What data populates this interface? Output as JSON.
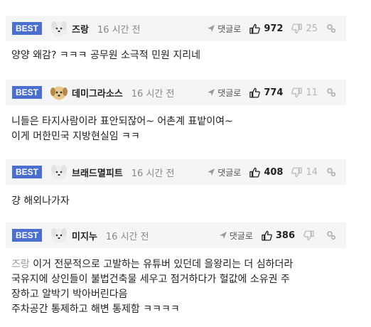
{
  "comments": [
    {
      "badge": "BEST",
      "nick": "즈랑",
      "time": "16 시간 전",
      "reply_label": "댓글로",
      "likes": "972",
      "dislikes": "25",
      "avatar": "white-dog-avatar",
      "text": "양양 왜감? ㅋㅋㅋ 공무원 소극적 민원 지리네"
    },
    {
      "badge": "BEST",
      "nick": "데미그라소스",
      "time": "16 시간 전",
      "reply_label": "댓글로",
      "likes": "774",
      "dislikes": "11",
      "avatar": "puppy-avatar",
      "text": "니들은 타지사람이라 표안되잖어~ 어촌계 표밭이여~\n이게 머한민국 지방현실임 ㅋㅋ"
    },
    {
      "badge": "BEST",
      "nick": "브래드멸피트",
      "time": "16 시간 전",
      "reply_label": "댓글로",
      "likes": "408",
      "dislikes": "14",
      "avatar": "white-dog-avatar",
      "text": "걍 해외나가자"
    },
    {
      "badge": "BEST",
      "nick": "미지누",
      "time": "16 시간 전",
      "reply_label": "댓글로",
      "likes": "386",
      "dislikes": "",
      "avatar": "white-dog-avatar",
      "mention": "즈랑",
      "text": " 이거 전문적으로 고발하는 유튜버 있던데 을왕리는 더 심하더라\n국유지에 상인들이 불법건축물 세우고 점거하다가 헐값에 소유권 주\n장하고 알박기 박아버린다음\n주차공간 통제하고 해변 통제함 ㅋㅋㅋㅋ"
    }
  ],
  "colors": {
    "badge": "#4a6fd0",
    "header_bg": "#f4f5f7",
    "muted": "#888888"
  }
}
